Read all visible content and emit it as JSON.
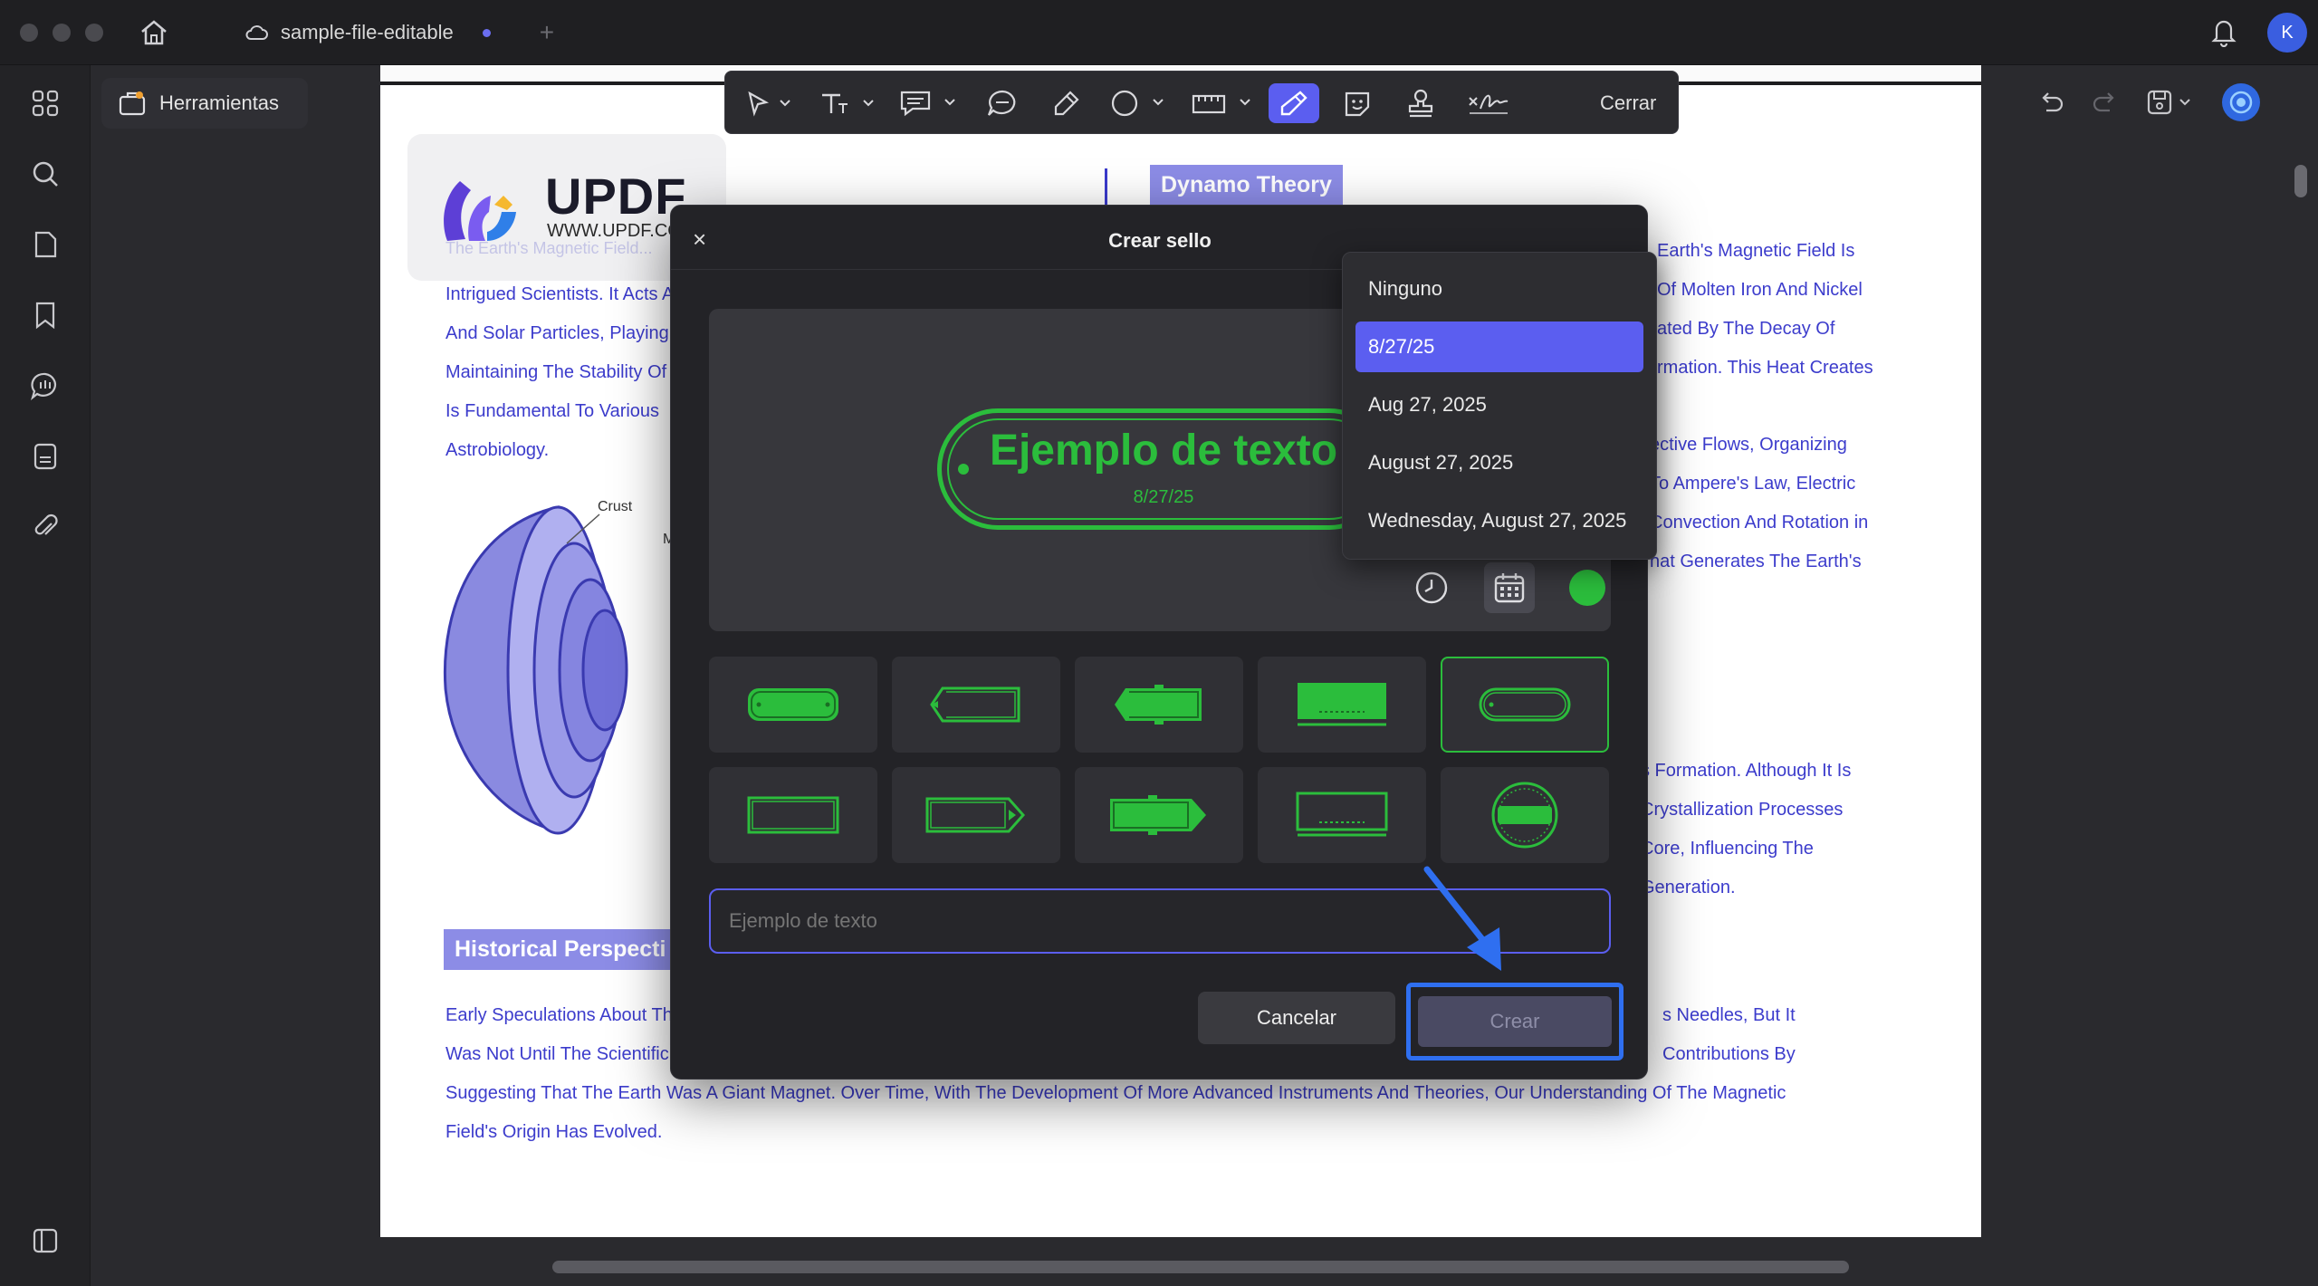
{
  "titlebar": {
    "tab_title": "sample-file-editable",
    "avatar_initial": "K"
  },
  "toolbar": {
    "tools_label": "Herramientas",
    "close_label": "Cerrar"
  },
  "document": {
    "logo_word": "UPDF",
    "logo_url": "WWW.UPDF.CO",
    "faded_line": "The Earth's Magnetic Field...",
    "left_lines": [
      "Intrigued Scientists. It Acts A",
      "And Solar Particles, Playing",
      "Maintaining The Stability Of",
      "Is Fundamental To Various",
      "Astrobiology."
    ],
    "diagram_label_crust": "Crust",
    "diagram_label_mantle": "M",
    "dynamo_heading": "Dynamo Theory",
    "right_lines_1": [
      "Earth's Magnetic Field Is",
      "Of Molten Iron And Nickel",
      "ated By The Decay Of",
      "rmation. This Heat Creates"
    ],
    "right_lines_2": [
      "ective Flows, Organizing",
      "To Ampere's Law, Electric",
      "Convection And Rotation in",
      "hat Generates The Earth's"
    ],
    "right_lines_3": [
      "s Formation. Although It Is",
      "Crystallization Processes",
      "Core, Influencing The",
      "Generation."
    ],
    "historical_heading": "Historical Perspecti",
    "bottom_left_lines": [
      "Early Speculations About Th",
      "Was Not Until The Scientific"
    ],
    "bottom_right_lines": [
      "s Needles, But It",
      "Contributions By"
    ],
    "full_line_1": "Suggesting That The Earth Was A Giant Magnet. Over Time, With The Development Of More Advanced Instruments And Theories, Our Understanding Of The Magnetic",
    "full_line_2": "Field's Origin Has Evolved."
  },
  "dialog": {
    "title": "Crear sello",
    "close_glyph": "×",
    "stamp_text": "Ejemplo de texto",
    "stamp_date": "8/27/25",
    "stamp_color": "#2bbd3c",
    "input_placeholder": "Ejemplo de texto",
    "cancel_label": "Cancelar",
    "create_label": "Crear"
  },
  "date_dropdown": {
    "items": [
      "Ninguno",
      "8/27/25",
      "Aug 27, 2025",
      "August 27, 2025",
      "Wednesday, August 27, 2025"
    ],
    "selected_index": 1
  },
  "colors": {
    "accent": "#5b5ef0",
    "highlight_frame": "#2f6ff0",
    "stamp_green": "#2bbd3c",
    "doc_text": "#3c3ccc"
  },
  "icons": {
    "rail": [
      "grid-icon",
      "search-icon",
      "pages-icon",
      "bookmark-icon",
      "comment-icon",
      "form-icon",
      "attachment-icon"
    ],
    "annot": [
      "select-icon",
      "text-icon",
      "note-icon",
      "comment-icon",
      "highlighter-icon",
      "shape-icon",
      "measure-icon",
      "stamp-pen-icon",
      "sticker-icon",
      "stamp-icon",
      "signature-icon"
    ]
  }
}
